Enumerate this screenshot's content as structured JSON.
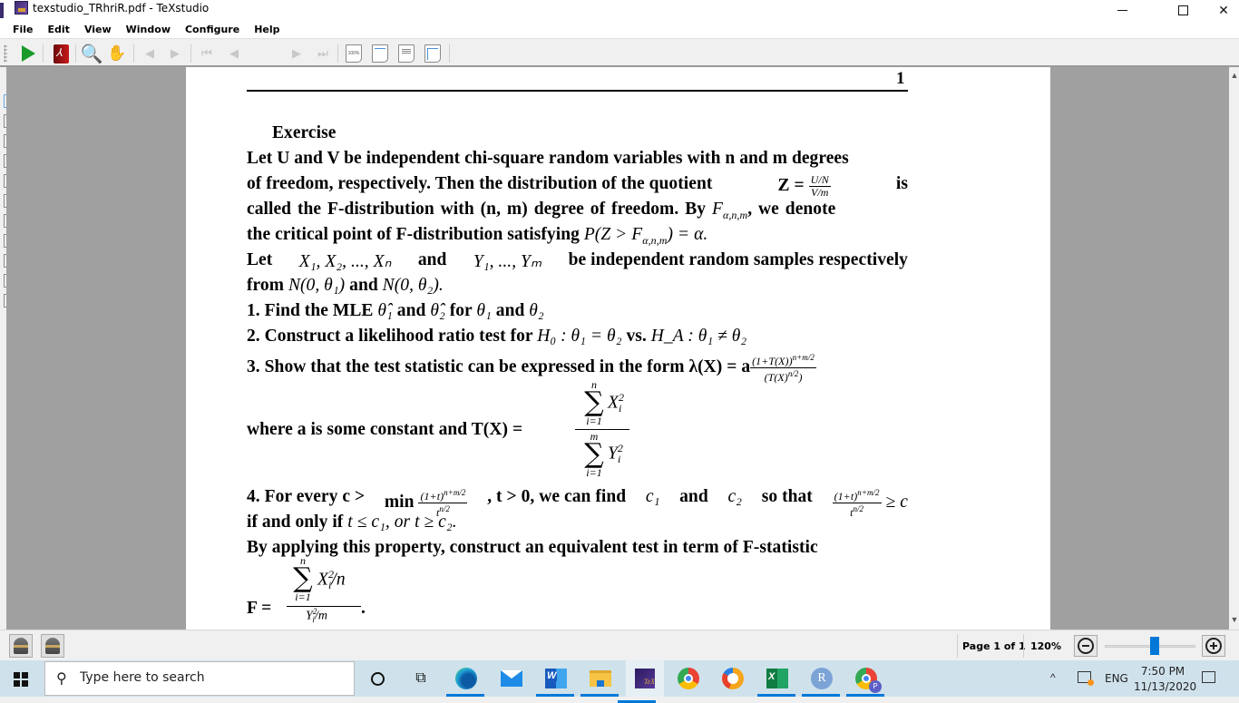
{
  "window": {
    "title": "texstudio_TRhriR.pdf - TeXstudio",
    "controls": {
      "minimize": "minimize",
      "maximize": "maximize",
      "close": "✕"
    }
  },
  "menu": [
    "File",
    "Edit",
    "View",
    "Window",
    "Configure",
    "Help"
  ],
  "toolbar": {
    "icons": [
      "compile-play-icon",
      "pdf-book-icon",
      "magnifier-icon",
      "hand-tool-icon",
      "back-icon",
      "forward-icon",
      "first-page-icon",
      "previous-page-icon",
      "next-page-icon",
      "last-page-icon",
      "zoom-100-icon",
      "fit-width-icon",
      "fit-text-width-icon",
      "fit-page-icon"
    ],
    "page_input": "1",
    "page_of": "of 1",
    "zoom100_label": "100%",
    "back_glyph": "◀",
    "fwd_glyph": "▶",
    "first_glyph": "⏮",
    "prev_glyph": "◀",
    "next_glyph": "▶",
    "last_glyph": "⏭",
    "search_glyph": "🔍",
    "hand_glyph": "✋"
  },
  "document": {
    "page_number": "1",
    "heading": "Exercise",
    "para1": {
      "l1": "Let U and V be independent chi-square random variables with n and m degrees",
      "l2_a": "of freedom, respectively. Then the distribution of the quotient",
      "l2_z": "Z =",
      "l2_num": "U/N",
      "l2_den": "V/m",
      "l2_b": "is",
      "l3_a": "called the F-distribution with (n, m) degree of freedom. By",
      "l3_F": "F",
      "l3_sub": "α,n,m",
      "l3_b": ", we denote",
      "l4_a": "the critical point of F-distribution satisfying",
      "l4_math": "P(Z > F",
      "l4_sub": "α,n,m",
      "l4_end": ") = α."
    },
    "para2": {
      "l1_a": "Let",
      "l1_x": "X₁, X₂, ..., Xₙ",
      "l1_b": "and",
      "l1_y": "Y₁, ..., Yₘ",
      "l1_c": "be independent random samples respectively",
      "l2_a": "from",
      "l2_n1": "N(0, θ₁)",
      "l2_b": "and",
      "l2_n2": "N(0, θ₂)."
    },
    "item1": {
      "a": "1. Find the MLE",
      "t1": "θ̂₁",
      "b": "and",
      "t2": "θ̂₂",
      "c": "for",
      "t3": "θ₁",
      "d": "and",
      "t4": "θ₂"
    },
    "item2": {
      "a": "2. Construct a likelihood ratio test for",
      "h0": "H₀ : θ₁ = θ₂",
      "b": "vs.",
      "ha": "H_A : θ₁ ≠ θ₂"
    },
    "item3": {
      "a": "3. Show that the test statistic can be expressed in the form",
      "lam": "λ(X) = a",
      "num": "(1+T(X))^(n+m/2)",
      "num_base": "(1+T(X))",
      "num_exp": "n+m/2",
      "den": "(T(X)^(n/2))",
      "den_base": "(T(X)",
      "den_exp": "n/2",
      "den_close": ")"
    },
    "where_line": {
      "a": "where a is some constant and T(X) =",
      "sum_top_upper": "n",
      "sum_top_body": "X",
      "sum_top_sup": "2",
      "sum_top_sub": "i",
      "sum_top_lower": "i=1",
      "sum_bot_upper": "m",
      "sum_bot_body": "Y",
      "sum_bot_sup": "2",
      "sum_bot_sub": "i",
      "sum_bot_lower": "i=1",
      "sigma": "∑"
    },
    "item4": {
      "a": "4. For every c >",
      "min": "min",
      "f1_num_base": "(1+t)",
      "f1_num_exp": "n+m/2",
      "f1_den_base": "t",
      "f1_den_exp": "n/2",
      "b": ", t > 0, we can find",
      "c1": "c₁",
      "and": "and",
      "c2": "c₂",
      "so": "so that",
      "geq": "≥ c",
      "l2": "if and only if",
      "cond": "t ≤ c₁, or t ≥ c₂."
    },
    "apply_line": "By applying this property, construct an equivalent test in term of F-statistic",
    "f_stat": {
      "lhs": "F =",
      "upper": "n",
      "sigma": "∑",
      "num_body": "X",
      "num_sup": "2",
      "num_sub": "i",
      "num_tail": "/n",
      "lower": "i=1",
      "den": "Y",
      "den_sup": "2",
      "den_sub": "i",
      "den_tail": "/m",
      "end": "."
    }
  },
  "statusbar": {
    "page_status": "Page 1 of 1",
    "zoom": "120%",
    "zoom_slider_fraction": 0.55
  },
  "taskbar": {
    "search_placeholder": "Type here to search",
    "apps": [
      "Microsoft Edge",
      "Mail",
      "Word",
      "File Explorer",
      "TeXstudio",
      "Google Chrome",
      "Avast Secure Browser",
      "Excel",
      "R",
      "Chrome Profile P"
    ],
    "r_label": "R",
    "profile_label": "P",
    "tray": {
      "up_glyph": "^",
      "language": "ENG",
      "time": "7:50 PM",
      "date": "11/13/2020"
    }
  }
}
